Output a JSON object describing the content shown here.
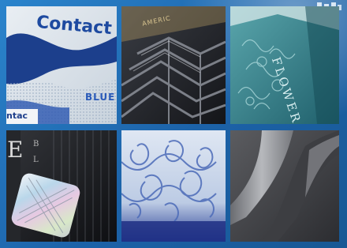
{
  "photos": [
    {
      "text": [
        "Contact",
        "BLUE",
        "ntac"
      ]
    },
    {
      "text": [
        "AMERIC"
      ]
    },
    {
      "text": [
        "FLOWER"
      ]
    },
    {
      "text": [
        "E",
        "B",
        "L"
      ]
    },
    {
      "text": []
    },
    {
      "text": []
    }
  ]
}
